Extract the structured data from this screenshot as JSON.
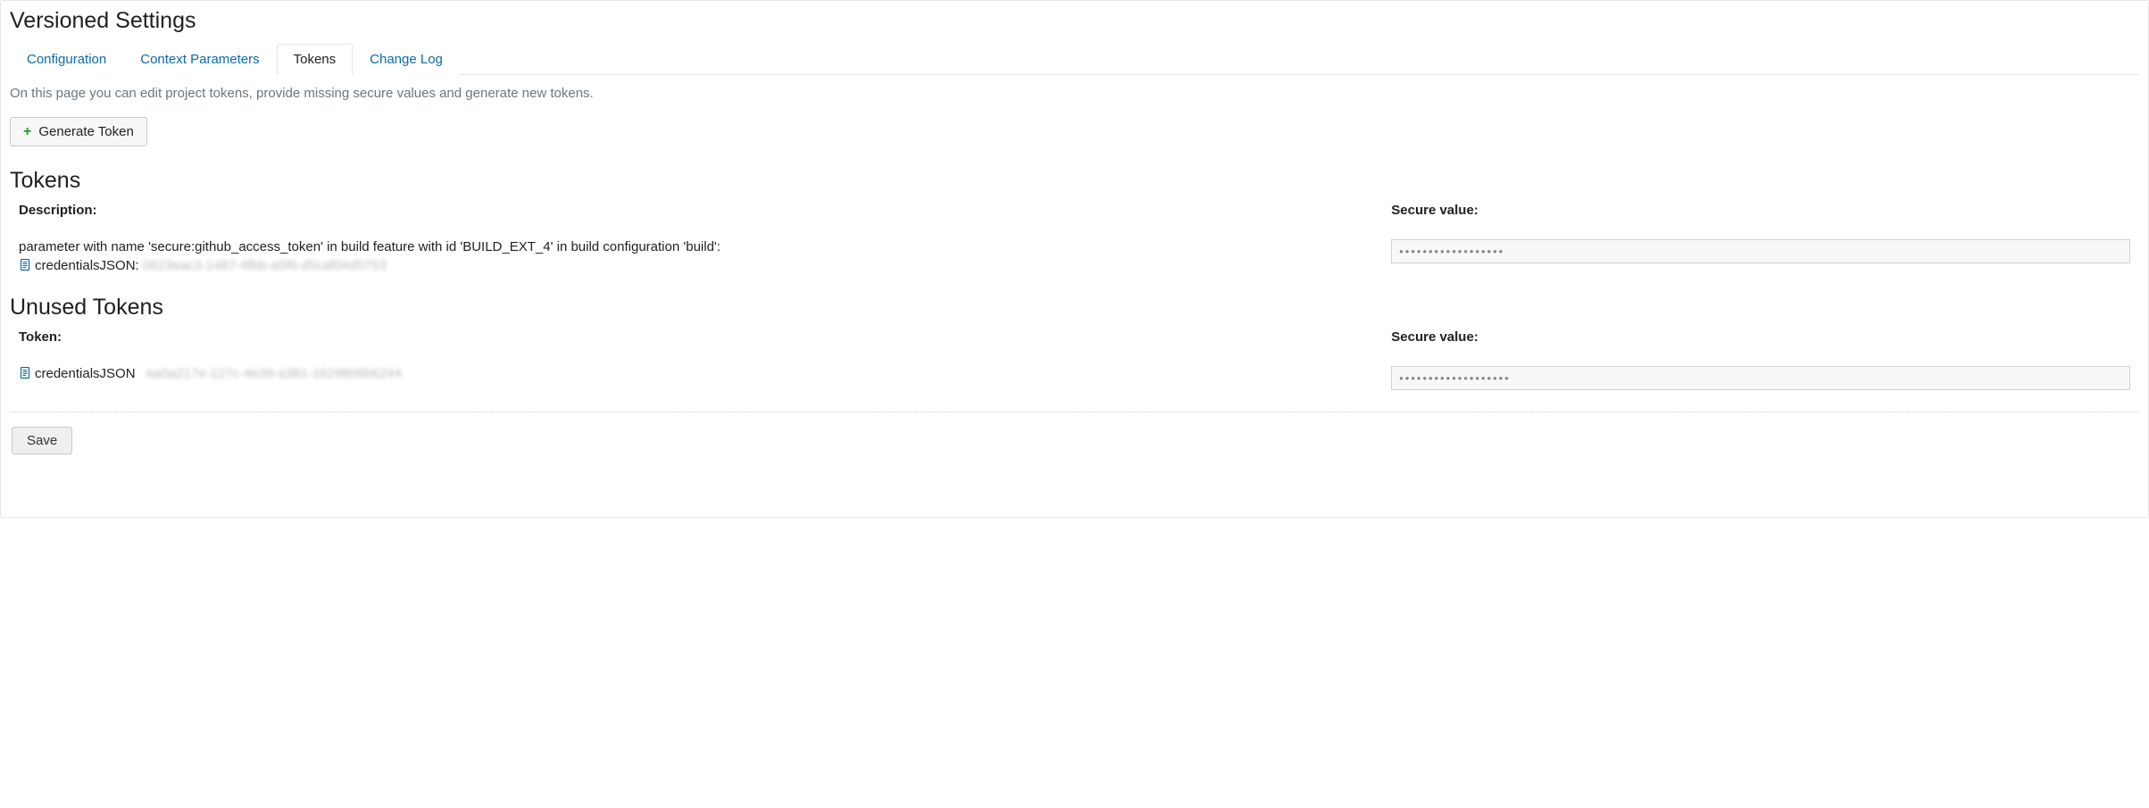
{
  "header": {
    "title": "Versioned Settings",
    "tabs": [
      {
        "label": "Configuration",
        "active": false
      },
      {
        "label": "Context Parameters",
        "active": false
      },
      {
        "label": "Tokens",
        "active": true
      },
      {
        "label": "Change Log",
        "active": false
      }
    ],
    "intro": "On this page you can edit project tokens, provide missing secure values and generate new tokens."
  },
  "buttons": {
    "generate": "Generate Token",
    "save": "Save"
  },
  "tokens_section": {
    "title": "Tokens",
    "col_desc": "Description:",
    "col_secure": "Secure value:",
    "rows": [
      {
        "description": "parameter with name 'secure:github_access_token' in build feature with id 'BUILD_EXT_4' in build configuration 'build':",
        "cred_label": "credentialsJSON:",
        "cred_hash": "0623eac3-1487-4fbb-a5f6-d5caf04d5753",
        "secure_value": "••••••••••••••••••"
      }
    ]
  },
  "unused_section": {
    "title": "Unused Tokens",
    "col_token": "Token:",
    "col_secure": "Secure value:",
    "rows": [
      {
        "cred_label": "credentialsJSON",
        "cred_hash": "ea0a217e-127c-4e39-a381-1629806b6244",
        "secure_value": "•••••••••••••••••••"
      }
    ]
  }
}
